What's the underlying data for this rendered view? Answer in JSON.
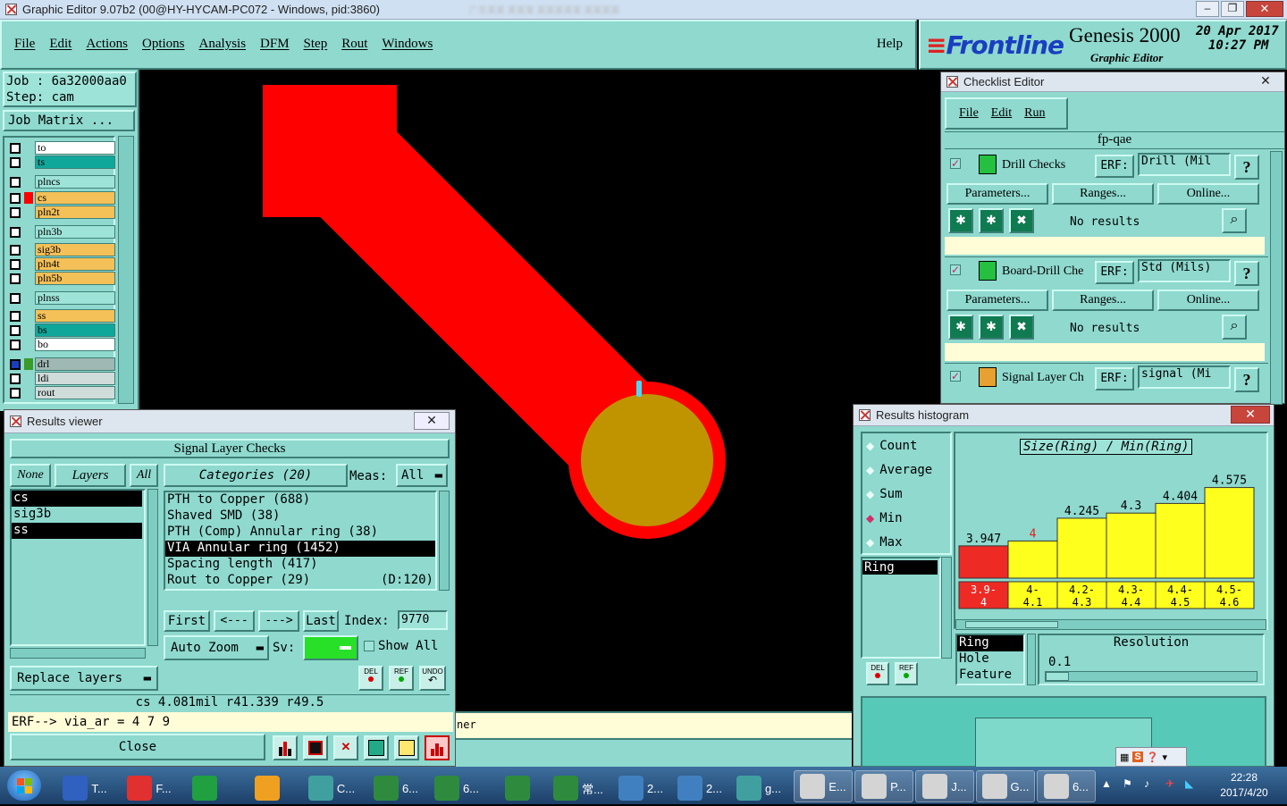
{
  "window": {
    "title": "Graphic Editor 9.07b2 (00@HY-HYCAM-PC072 - Windows, pid:3860)",
    "blurred_title": "广东某某 某某某 某某某某某 某某某某"
  },
  "menu": {
    "items": [
      "File",
      "Edit",
      "Actions",
      "Options",
      "Analysis",
      "DFM",
      "Step",
      "Rout",
      "Windows"
    ],
    "help": "Help"
  },
  "brand": {
    "logo": "Frontline",
    "product": "Genesis 2000",
    "subtitle": "Graphic Editor",
    "date": "20 Apr 2017",
    "time": "10:27 PM"
  },
  "job": {
    "job": "Job : 6a32000aa0",
    "step": "Step: cam",
    "matrix_button": "Job Matrix ..."
  },
  "layers": [
    {
      "name": "to",
      "color": "#ffffff",
      "swatch": "",
      "arrow": true
    },
    {
      "name": "ts",
      "color": "#0fa79a",
      "swatch": ""
    },
    {
      "name": "plncs",
      "color": "#9ee3d8",
      "swatch": ""
    },
    {
      "name": "cs",
      "color": "#f4c058",
      "swatch": "#ff0000"
    },
    {
      "name": "pln2t",
      "color": "#f4c058",
      "swatch": ""
    },
    {
      "name": "pln3b",
      "color": "#9ee3d8",
      "swatch": ""
    },
    {
      "name": "sig3b",
      "color": "#f4c058",
      "swatch": ""
    },
    {
      "name": "pln4t",
      "color": "#f4c058",
      "swatch": ""
    },
    {
      "name": "pln5b",
      "color": "#f4c058",
      "swatch": ""
    },
    {
      "name": "plnss",
      "color": "#9ee3d8",
      "swatch": ""
    },
    {
      "name": "ss",
      "color": "#f4c058",
      "swatch": ""
    },
    {
      "name": "bs",
      "color": "#0fa79a",
      "swatch": ""
    },
    {
      "name": "bo",
      "color": "#ffffff",
      "swatch": "",
      "arrow": true
    },
    {
      "name": "drl",
      "color": "#9fb8b4",
      "swatch": "#3a9a2a",
      "blue": true
    },
    {
      "name": "ldi",
      "color": "#d0dcda",
      "swatch": ""
    },
    {
      "name": "rout",
      "color": "#d0dcda",
      "swatch": ""
    }
  ],
  "results_viewer": {
    "title": "Results viewer",
    "header": "Signal Layer Checks",
    "none": "None",
    "layers_btn": "Layers",
    "all": "All",
    "layer_list": [
      "cs",
      "sig3b",
      "ss"
    ],
    "categories_btn": "Categories (20)",
    "meas_label": "Meas:",
    "meas_value": "All",
    "categories": [
      {
        "text": "PTH to Copper (688)",
        "sel": false
      },
      {
        "text": "Shaved SMD (38)",
        "sel": false
      },
      {
        "text": "PTH (Comp) Annular ring (38)",
        "sel": false
      },
      {
        "text": "VIA Annular ring (1452)",
        "sel": true
      },
      {
        "text": "Spacing length (417)",
        "sel": false
      },
      {
        "text": "Rout to Copper (29)",
        "sel": false
      }
    ],
    "rout_extra": "(D:120)",
    "nav": {
      "first": "First",
      "prev": "<---",
      "next": "--->",
      "last": "Last",
      "index_label": "Index:",
      "index_value": "9770"
    },
    "auto_zoom": "Auto Zoom",
    "sv_label": "Sv:",
    "show_all": "Show All",
    "replace_layers": "Replace layers",
    "tool_btns": [
      "DEL",
      "REF",
      "UNDO"
    ],
    "status": "cs 4.081mil  r41.339  r49.5",
    "erf": "ERF--> via_ar = 4 7 9",
    "close": "Close"
  },
  "checklist": {
    "title": "Checklist Editor",
    "menu": [
      "File",
      "Edit",
      "Run"
    ],
    "name": "fp-qae",
    "checks": [
      {
        "name": "Drill Checks",
        "erf_label": "ERF:",
        "erf": "Drill (Mil",
        "result": "No results"
      },
      {
        "name": "Board-Drill Che",
        "erf_label": "ERF:",
        "erf": "Std (Mils)",
        "result": "No results"
      },
      {
        "name": "Signal Layer Ch",
        "erf_label": "ERF:",
        "erf": "signal (Mi",
        "result": ""
      }
    ],
    "row_buttons": [
      "Parameters...",
      "Ranges...",
      "Online..."
    ],
    "help": "?"
  },
  "histogram": {
    "title": "Results histogram",
    "modes": [
      "Count",
      "Average",
      "Sum",
      "Min",
      "Max"
    ],
    "selected_mode": "Min",
    "measure_list": [
      "Ring"
    ],
    "chart_title": "Size(Ring) / Min(Ring)",
    "bottom_list": [
      "Ring",
      "Hole",
      "Feature"
    ],
    "resolution_label": "Resolution",
    "resolution_value": "0.1",
    "tool_btns": [
      "DEL",
      "REF"
    ]
  },
  "chart_data": {
    "type": "bar",
    "title": "Size(Ring) / Min(Ring)",
    "categories": [
      "3.9-4",
      "4-4.1",
      "4.2-4.3",
      "4.3-4.4",
      "4.4-4.5",
      "4.5-4.6"
    ],
    "values": [
      3.947,
      4,
      4.245,
      4.3,
      4.404,
      4.575
    ],
    "value_labels": [
      "3.947",
      "4",
      "4.245",
      "4.3",
      "4.404",
      "4.575"
    ],
    "colors": [
      "#ee2a24",
      "#ffff1e",
      "#ffff1e",
      "#ffff1e",
      "#ffff1e",
      "#ffff1e"
    ],
    "ylim": [
      3.6,
      4.6
    ]
  },
  "bottom_partial": "ner",
  "taskbar": {
    "items": [
      {
        "label": "T...",
        "color": "#3060c0"
      },
      {
        "label": "F...",
        "color": "#e03030"
      },
      {
        "label": "",
        "color": "#20a040"
      },
      {
        "label": "",
        "color": "#f0a020"
      },
      {
        "label": "C...",
        "color": "#40a0a0"
      },
      {
        "label": "6...",
        "color": "#2e8b3e"
      },
      {
        "label": "6...",
        "color": "#2e8b3e"
      },
      {
        "label": "",
        "color": "#2e8b3e"
      },
      {
        "label": "常...",
        "color": "#2e8b3e"
      },
      {
        "label": "2...",
        "color": "#4080c0"
      },
      {
        "label": "2...",
        "color": "#4080c0"
      },
      {
        "label": "g...",
        "color": "#40a0a0"
      },
      {
        "label": "E...",
        "color": "#d4d4d4"
      },
      {
        "label": "P...",
        "color": "#d4d4d4"
      },
      {
        "label": "J...",
        "color": "#d4d4d4"
      },
      {
        "label": "G...",
        "color": "#d4d4d4"
      },
      {
        "label": "6...",
        "color": "#d4d4d4"
      }
    ],
    "clock_time": "22:28",
    "clock_date": "2017/4/20"
  }
}
